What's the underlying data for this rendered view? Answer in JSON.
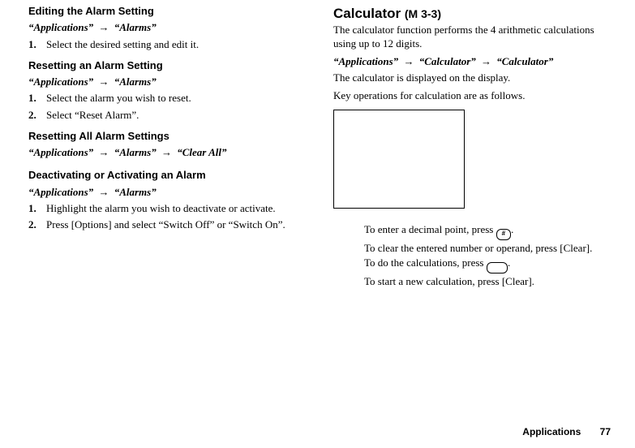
{
  "left": {
    "editHeading": "Editing the Alarm Setting",
    "editCrumb": {
      "a": "“Applications”",
      "b": "“Alarms”"
    },
    "editStep1": "Select the desired setting and edit it.",
    "resetHeading": "Resetting an Alarm Setting",
    "resetCrumb": {
      "a": "“Applications”",
      "b": "“Alarms”"
    },
    "resetStep1": "Select the alarm you wish to reset.",
    "resetStep2": "Select “Reset Alarm”.",
    "resetAllHeading": "Resetting All Alarm Settings",
    "resetAllCrumb": {
      "a": "“Applications”",
      "b": "“Alarms”",
      "c": "“Clear All”"
    },
    "deactHeading": "Deactivating or Activating an Alarm",
    "deactCrumb": {
      "a": "“Applications”",
      "b": "“Alarms”"
    },
    "deactStep1": "Highlight the alarm you wish to deactivate or activate.",
    "deactStep2": "Press [Options] and select “Switch Off” or “Switch On”."
  },
  "right": {
    "calcHeading": "Calculator",
    "menuRef": "(M 3-3)",
    "intro": "The calculator function performs the 4 arithmetic calculations using up to 12 digits.",
    "calcCrumb": {
      "a": "“Applications”",
      "b": "“Calculator”",
      "c": "“Calculator”"
    },
    "line1": "The calculator is displayed on the display.",
    "line2": "Key operations for calculation are as follows.",
    "note1a": "To enter a decimal point, press ",
    "note1b": ".",
    "note2": "To clear the entered number or operand, press [Clear].",
    "note3a": "To do the calculations, press ",
    "note3b": ".",
    "note4": "To start a new calculation, press [Clear].",
    "keyHash": "#"
  },
  "arrow": "→",
  "nums": {
    "one": "1.",
    "two": "2."
  },
  "footer": {
    "section": "Applications",
    "page": "77"
  }
}
